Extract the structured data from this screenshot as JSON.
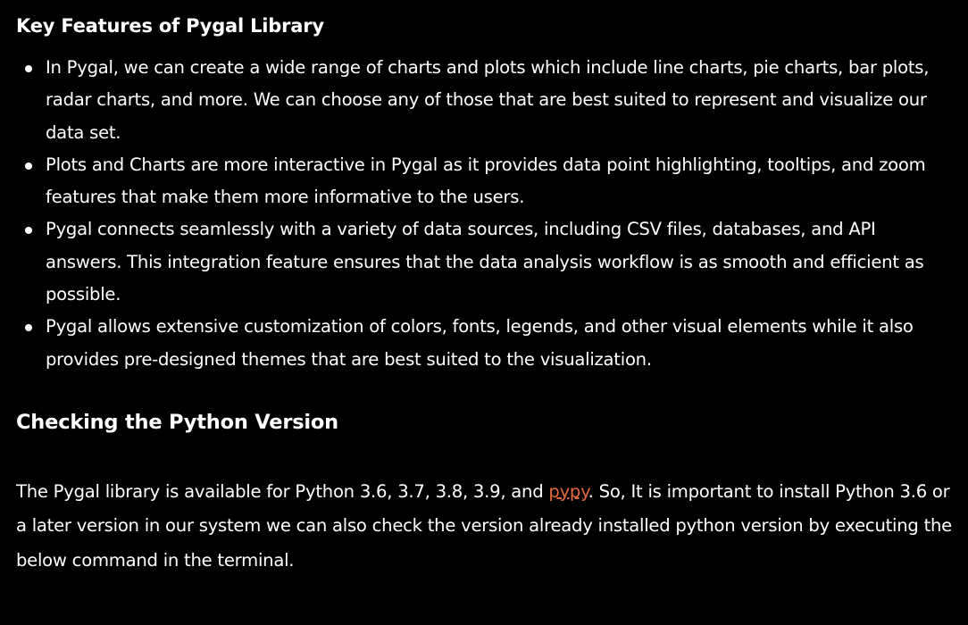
{
  "features_heading": "Key Features of Pygal Library",
  "features": [
    "In Pygal, we can create a wide range of charts and plots which include line charts, pie charts, bar plots, radar charts, and more. We can choose any of those that are best suited to represent and visualize our data set.",
    "Plots and Charts are more interactive in Pygal as it provides data point highlighting, tooltips, and zoom features that make them more informative to the users.",
    "Pygal connects seamlessly with a variety of data sources, including CSV files, databases, and API answers. This integration feature ensures that the data analysis workflow is as smooth and efficient as possible.",
    "Pygal allows extensive customization of colors, fonts, legends, and other visual elements while it also provides pre-designed themes that are best suited to the visualization."
  ],
  "python_heading": "Checking the Python Version",
  "paragraph": {
    "before_link": "The Pygal library is available for Python 3.6, 3.7, 3.8, 3.9, and ",
    "link_text": "pypy",
    "after_link": ". So, It is important to install Python 3.6 or a later version in our system we can also check the version already installed python version by executing the below command in the terminal."
  },
  "colors": {
    "background": "#000000",
    "text": "#ffffff",
    "link": "#e2673f"
  }
}
